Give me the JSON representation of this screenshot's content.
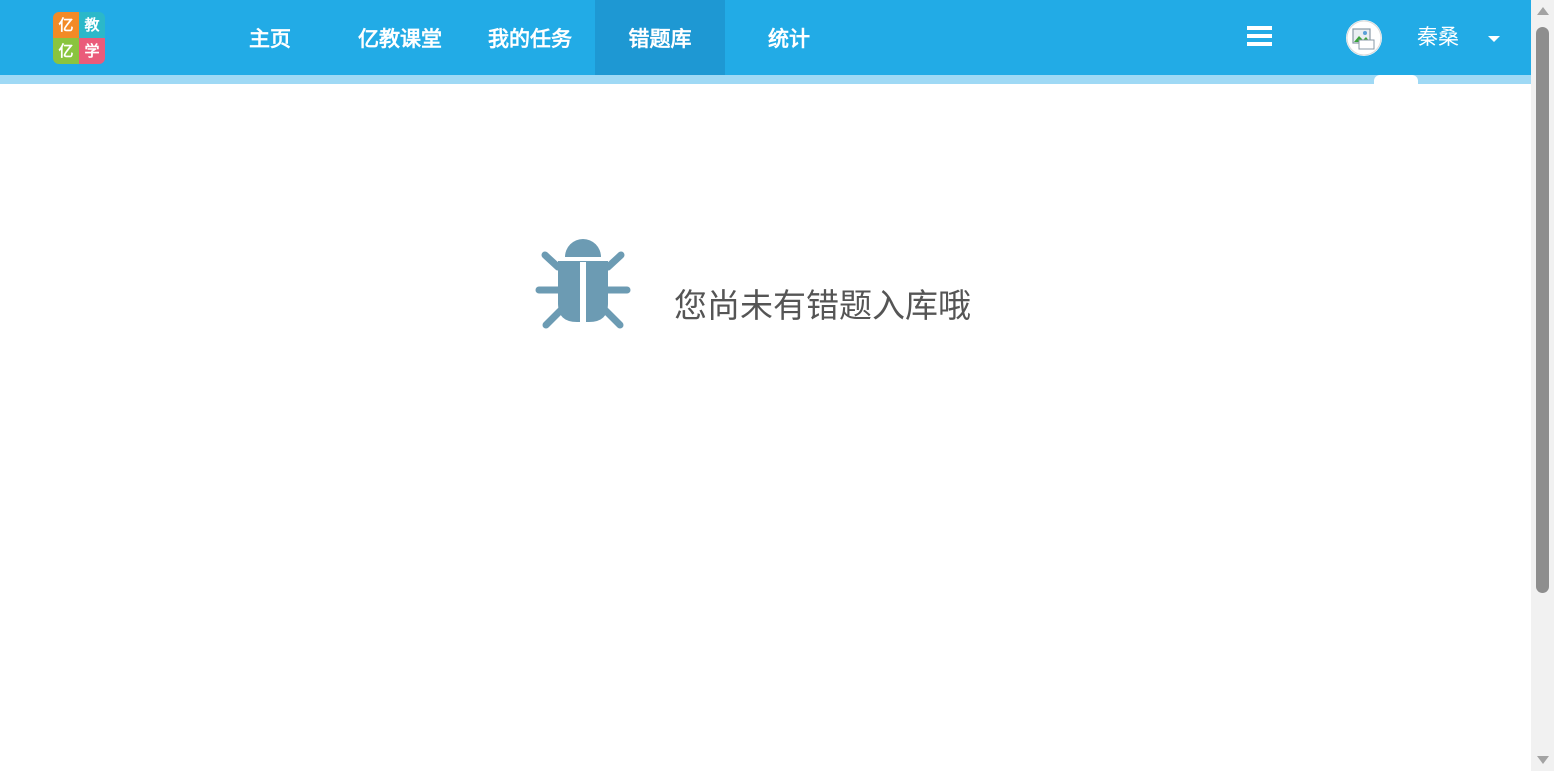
{
  "header": {
    "logo": {
      "chars": [
        "亿",
        "教",
        "亿",
        "学"
      ],
      "colors": [
        "#f28a26",
        "#2bb8c9",
        "#8ac43f",
        "#ea5b7a"
      ]
    },
    "nav": [
      {
        "label": "主页",
        "active": false
      },
      {
        "label": "亿教课堂",
        "active": false
      },
      {
        "label": "我的任务",
        "active": false
      },
      {
        "label": "错题库",
        "active": true
      },
      {
        "label": "统计",
        "active": false
      }
    ],
    "menu_icon": "hamburger-menu-icon",
    "user": {
      "name": "秦桑",
      "avatar_icon": "broken-image-avatar-icon",
      "dropdown_icon": "caret-down-icon"
    }
  },
  "main": {
    "empty_state": {
      "icon": "bug-icon",
      "message": "您尚未有错题入库哦"
    }
  },
  "colors": {
    "header_bg": "#22abe6",
    "nav_active_bg": "#1e98d3",
    "icon_color": "#6c9bb3",
    "text_color": "#555555"
  }
}
